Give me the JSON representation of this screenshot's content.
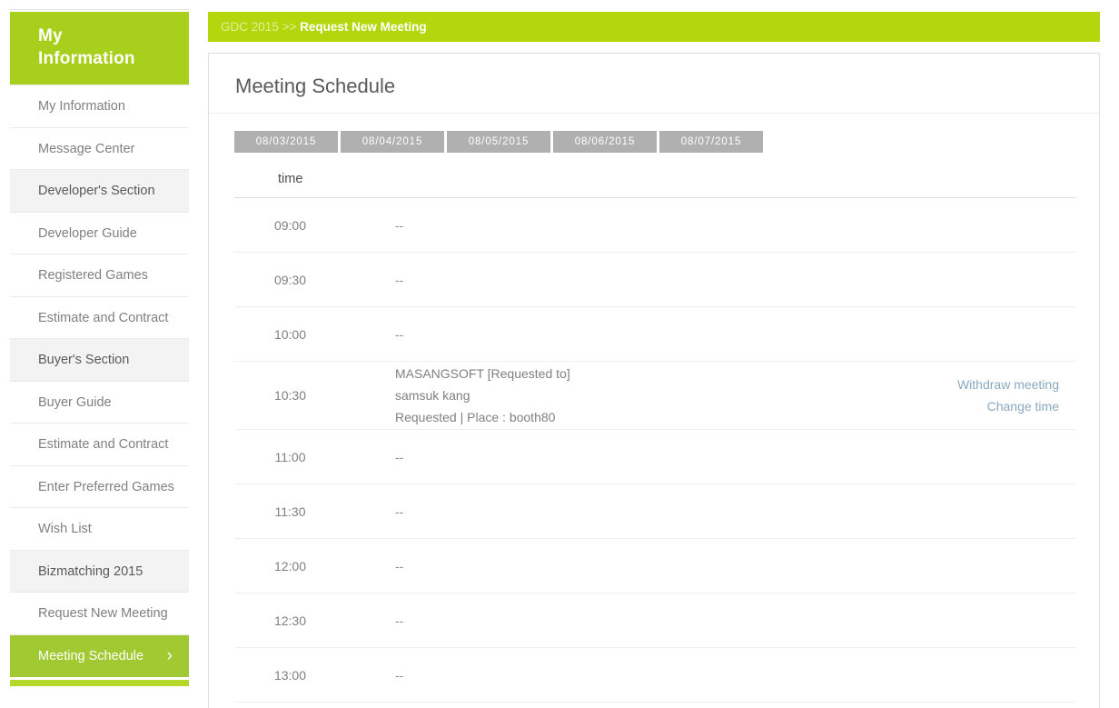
{
  "sidebar": {
    "header_line1": "My",
    "header_line2": "Information",
    "items": [
      {
        "label": "My Information",
        "type": "link"
      },
      {
        "label": "Message Center",
        "type": "link"
      },
      {
        "label": "Developer's Section",
        "type": "section"
      },
      {
        "label": "Developer Guide",
        "type": "link"
      },
      {
        "label": "Registered Games",
        "type": "link"
      },
      {
        "label": "Estimate and Contract",
        "type": "link"
      },
      {
        "label": "Buyer's Section",
        "type": "section"
      },
      {
        "label": "Buyer Guide",
        "type": "link"
      },
      {
        "label": "Estimate and Contract",
        "type": "link"
      },
      {
        "label": "Enter Preferred Games",
        "type": "link"
      },
      {
        "label": "Wish List",
        "type": "link"
      },
      {
        "label": "Bizmatching 2015",
        "type": "section"
      },
      {
        "label": "Request New Meeting",
        "type": "link"
      },
      {
        "label": "Meeting Schedule",
        "type": "active",
        "chevron": "›"
      }
    ]
  },
  "breadcrumb": {
    "root": "GDC 2015",
    "separator": ">>",
    "current": "Request New Meeting"
  },
  "page": {
    "title": "Meeting Schedule"
  },
  "date_tabs": [
    {
      "label": "08/03/2015",
      "selected": true
    },
    {
      "label": "08/04/2015",
      "selected": false
    },
    {
      "label": "08/05/2015",
      "selected": false
    },
    {
      "label": "08/06/2015",
      "selected": false
    },
    {
      "label": "08/07/2015",
      "selected": false
    }
  ],
  "table": {
    "header_time": "time",
    "empty_marker": "--",
    "rows": [
      {
        "time": "09:00",
        "empty": true
      },
      {
        "time": "09:30",
        "empty": true
      },
      {
        "time": "10:00",
        "empty": true
      },
      {
        "time": "10:30",
        "empty": false,
        "company": "MASANGSOFT [Requested to]",
        "person": "samsuk kang",
        "status": "Requested | Place : booth80",
        "actions": [
          "Withdraw meeting",
          "Change time"
        ]
      },
      {
        "time": "11:00",
        "empty": true
      },
      {
        "time": "11:30",
        "empty": true
      },
      {
        "time": "12:00",
        "empty": true
      },
      {
        "time": "12:30",
        "empty": true
      },
      {
        "time": "13:00",
        "empty": true
      }
    ]
  },
  "colors": {
    "brand_green": "#b2d70d",
    "header_green": "#a8cf1c",
    "active_green": "#a1c932",
    "tab_gray": "#b0b0b0",
    "link_blue": "#8aa9c0"
  }
}
